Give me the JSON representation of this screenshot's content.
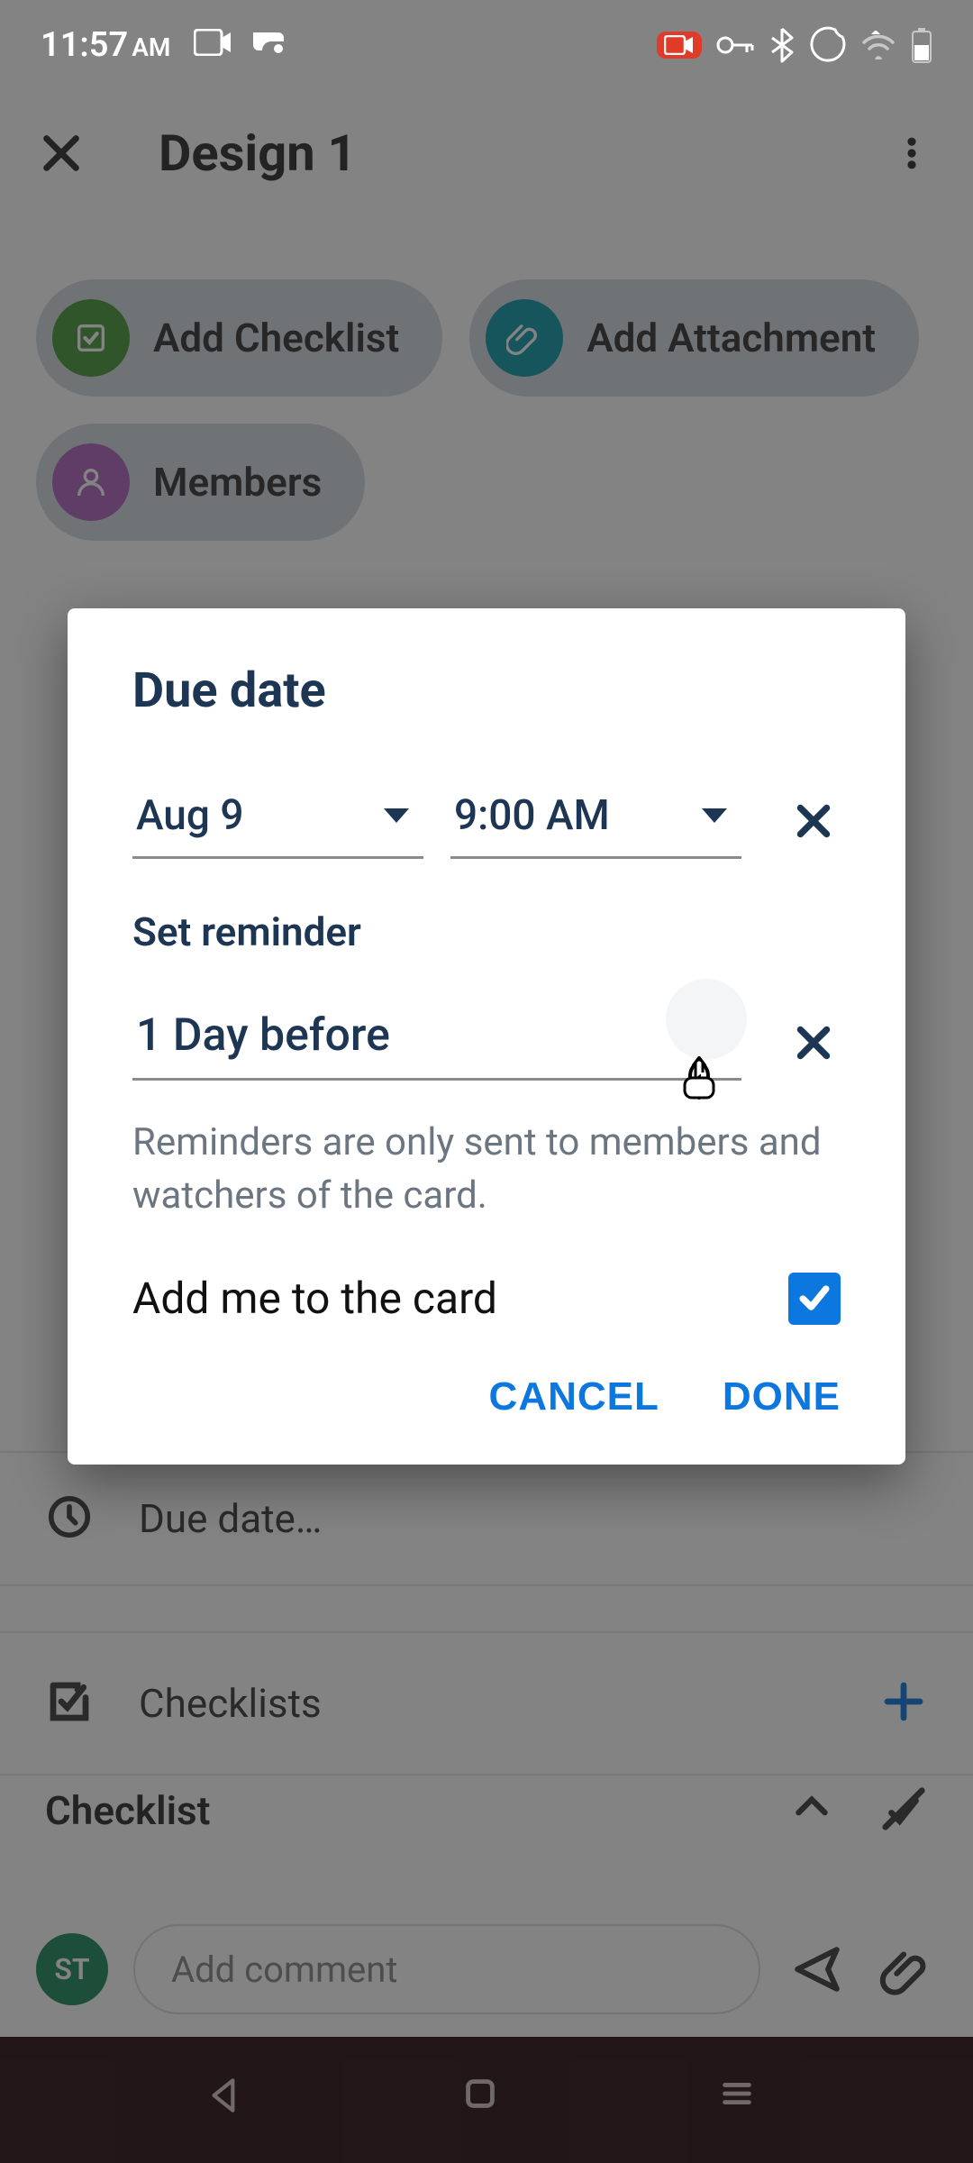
{
  "status": {
    "time": "11:57",
    "time_suffix": "AM"
  },
  "header": {
    "title": "Design 1"
  },
  "chips": {
    "checklist": "Add Checklist",
    "attachment": "Add Attachment",
    "members": "Members"
  },
  "bg": {
    "due_date_label": "Due date…",
    "checklists_label": "Checklists",
    "checklist_section": "Checklist"
  },
  "comment": {
    "avatar": "ST",
    "placeholder": "Add comment"
  },
  "dialog": {
    "title": "Due date",
    "date": "Aug 9",
    "time": "9:00 AM",
    "reminder_label": "Set reminder",
    "reminder_value": "1 Day before",
    "help": "Reminders are only sent to members and watchers of the card.",
    "add_me_label": "Add me to the card",
    "add_me_checked": true,
    "cancel": "CANCEL",
    "done": "DONE"
  }
}
